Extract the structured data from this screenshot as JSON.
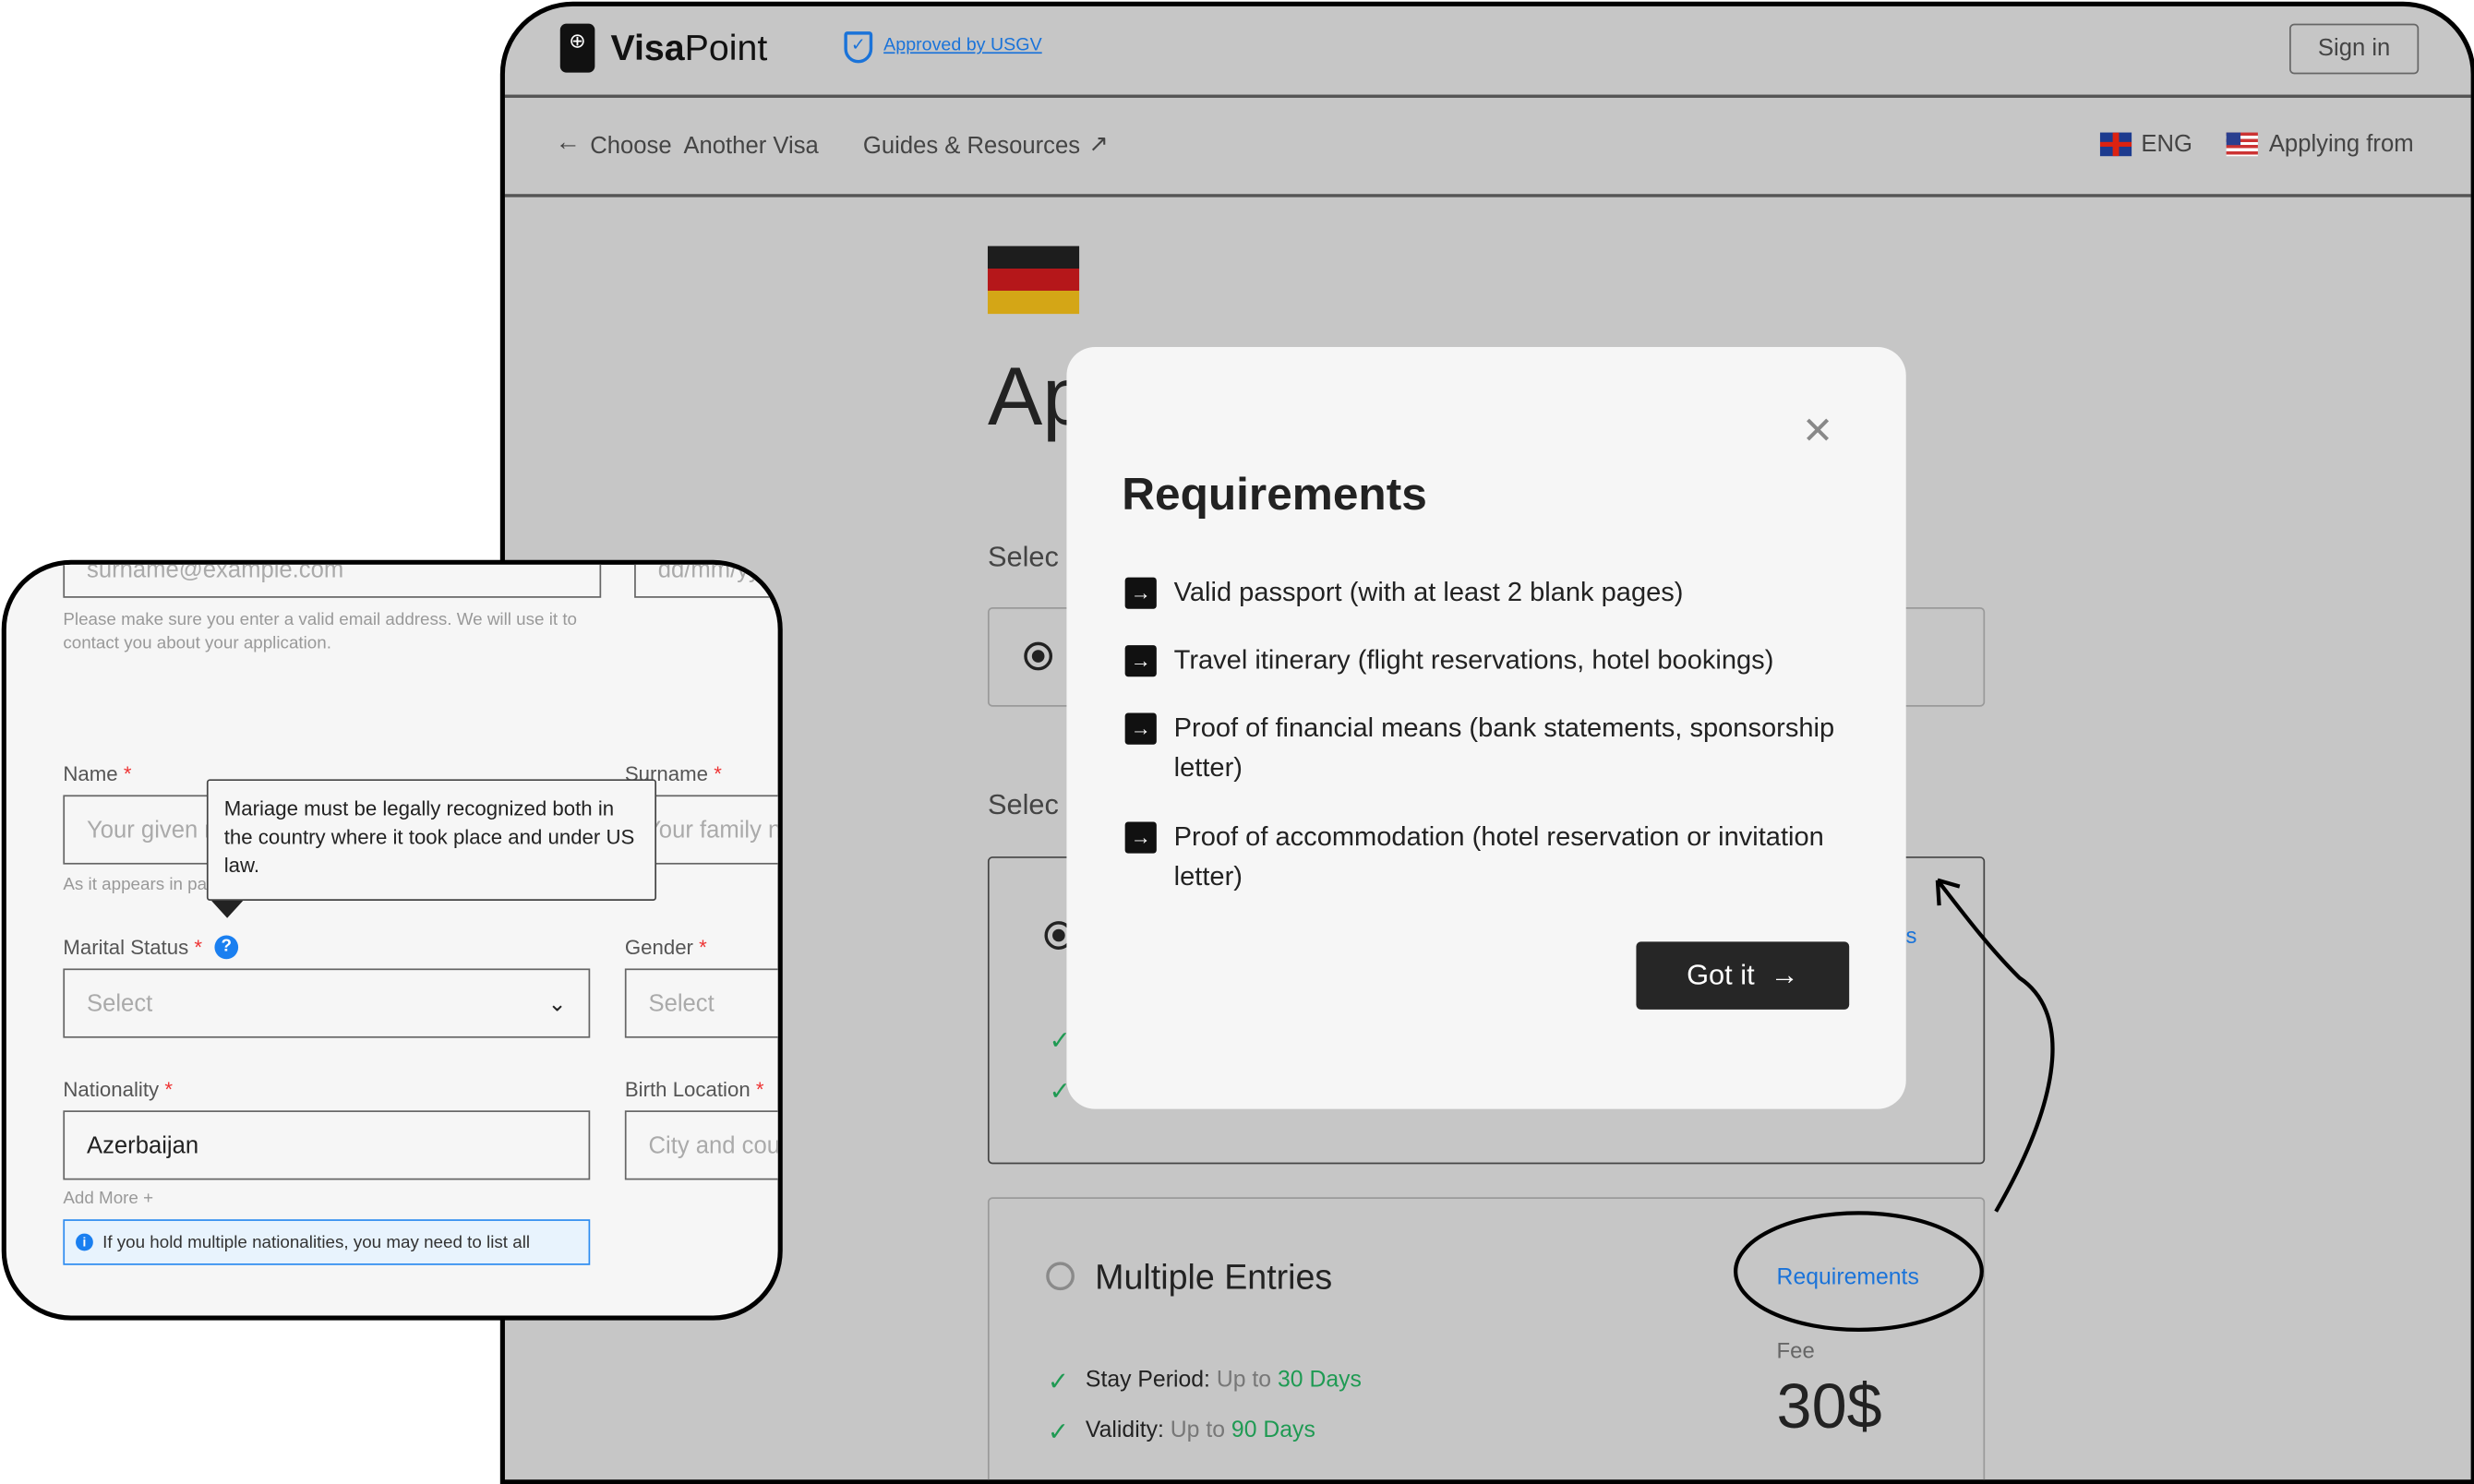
{
  "header": {
    "brand_bold": "Visa",
    "brand_light": "Point",
    "approved": "Approved by USGV",
    "sign_in": "Sign in"
  },
  "nav": {
    "back": "Choose  Another Visa",
    "guides": "Guides & Resources",
    "language": "ENG",
    "applying_from": "Applying from"
  },
  "page": {
    "title_partial": "Ap",
    "select_label_1": "Selec",
    "select_label_2": "Selec",
    "partial_link": "ts",
    "multiple": {
      "title": "Multiple Entries",
      "requirements_link": "Requirements",
      "fee_label": "Fee",
      "fee": "30$",
      "stay_label": "Stay Period:",
      "stay_prefix": "Up to",
      "stay_value": "30 Days",
      "validity_label": "Validity:",
      "validity_prefix": "Up to",
      "validity_value": "90 Days"
    }
  },
  "modal": {
    "title": "Requirements",
    "items": [
      "Valid passport (with at least 2 blank pages)",
      "Travel itinerary (flight reservations, hotel bookings)",
      "Proof of financial means (bank statements, sponsorship letter)",
      "Proof of accommodation (hotel reservation or invitation letter)"
    ],
    "button": "Got it"
  },
  "form": {
    "email_placeholder": "surname@example.com",
    "date_placeholder": "dd/mm/yyyy",
    "email_help": "Please make sure you enter a valid email address. We will use it to contact you about your application.",
    "name_label": "Name",
    "name_placeholder": "Your given name",
    "name_help": "As it appears in passport",
    "surname_label": "Surname",
    "surname_placeholder": "Your family name",
    "tooltip": "Mariage must be legally recognized both in the country where it took place and under US law.",
    "marital_label": "Marital Status",
    "marital_value": "Select",
    "gender_label": "Gender",
    "gender_value": "Select",
    "nationality_label": "Nationality",
    "nationality_value": "Azerbaijan",
    "birth_label": "Birth Location",
    "birth_placeholder": "City and country",
    "add_more": "Add More +",
    "info": "If you hold multiple nationalities, you may need to list all",
    "required": "*"
  },
  "colors": {
    "accent_blue": "#1a73d9",
    "green": "#1f9a53",
    "dark_button": "#262626",
    "overlay": "#c6c6c6"
  }
}
